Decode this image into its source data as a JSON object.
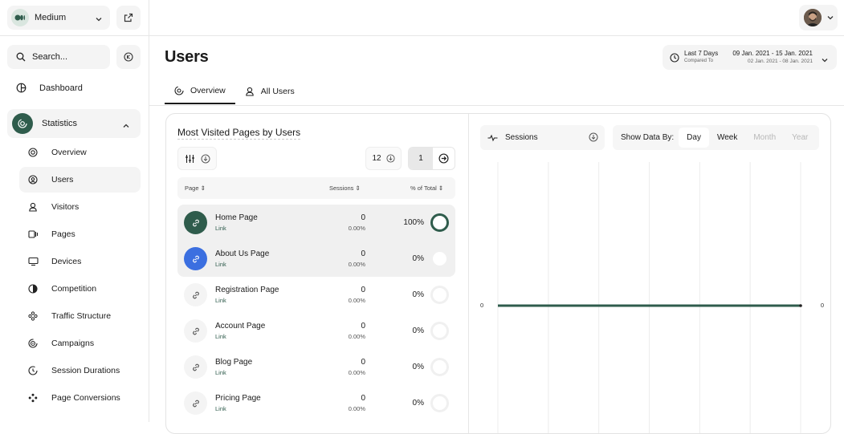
{
  "site": {
    "name": "Medium"
  },
  "search": {
    "placeholder": "Search..."
  },
  "nav": {
    "dashboard": "Dashboard",
    "statistics": "Statistics",
    "items": [
      {
        "label": "Overview",
        "icon": "target-icon"
      },
      {
        "label": "Users",
        "icon": "at-user-icon"
      },
      {
        "label": "Visitors",
        "icon": "person-icon"
      },
      {
        "label": "Pages",
        "icon": "pages-icon"
      },
      {
        "label": "Devices",
        "icon": "monitor-icon"
      },
      {
        "label": "Competition",
        "icon": "half-circle-icon"
      },
      {
        "label": "Traffic Structure",
        "icon": "network-icon"
      },
      {
        "label": "Campaigns",
        "icon": "campaign-icon"
      },
      {
        "label": "Session Durations",
        "icon": "timer-icon"
      },
      {
        "label": "Page Conversions",
        "icon": "conversion-icon"
      }
    ]
  },
  "header": {
    "title": "Users",
    "date_label": "Last 7 Days",
    "compared_label": "Compared To",
    "date_range": "09 Jan. 2021 - 15 Jan. 2021",
    "compare_range": "02 Jan. 2021 - 08 Jan. 2021"
  },
  "tabs": [
    {
      "label": "Overview"
    },
    {
      "label": "All Users"
    }
  ],
  "table": {
    "title": "Most Visited Pages by Users",
    "per_page": "12",
    "page": "1",
    "headers": {
      "page": "Page",
      "sessions": "Sessions",
      "pct": "% of Total"
    },
    "rows": [
      {
        "name": "Home Page",
        "link": "Link",
        "sessions": "0",
        "sessions_pct": "0.00%",
        "pct": "100%"
      },
      {
        "name": "About Us Page",
        "link": "Link",
        "sessions": "0",
        "sessions_pct": "0.00%",
        "pct": "0%"
      },
      {
        "name": "Registration Page",
        "link": "Link",
        "sessions": "0",
        "sessions_pct": "0.00%",
        "pct": "0%"
      },
      {
        "name": "Account Page",
        "link": "Link",
        "sessions": "0",
        "sessions_pct": "0.00%",
        "pct": "0%"
      },
      {
        "name": "Blog Page",
        "link": "Link",
        "sessions": "0",
        "sessions_pct": "0.00%",
        "pct": "0%"
      },
      {
        "name": "Pricing Page",
        "link": "Link",
        "sessions": "0",
        "sessions_pct": "0.00%",
        "pct": "0%"
      }
    ]
  },
  "chart_panel": {
    "metric": "Sessions",
    "show_by": "Show Data By:",
    "options": [
      "Day",
      "Week",
      "Month",
      "Year"
    ],
    "selected": "Day"
  },
  "chart_data": {
    "type": "line",
    "series": [
      {
        "values": [
          0,
          0,
          0,
          0,
          0,
          0,
          0
        ]
      }
    ],
    "y_left_label": "0",
    "y_right_label": "0",
    "grid": "vertical",
    "colors": {
      "line": "#2f5c4c"
    }
  },
  "colors": {
    "accent": "#2f5c4c",
    "blue": "#3b6fe0"
  }
}
